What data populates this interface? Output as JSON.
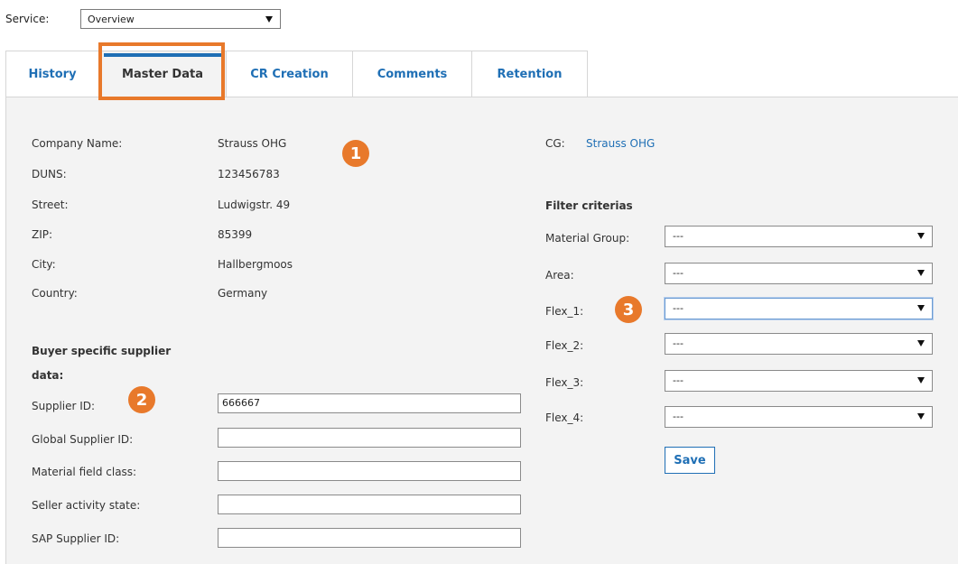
{
  "service": {
    "label": "Service:",
    "selected": "Overview"
  },
  "tabs": [
    {
      "label": "History"
    },
    {
      "label": "Master Data"
    },
    {
      "label": "CR Creation"
    },
    {
      "label": "Comments"
    },
    {
      "label": "Retention"
    }
  ],
  "master": {
    "company_name_label": "Company Name:",
    "company_name": "Strauss OHG",
    "duns_label": "DUNS:",
    "duns": "123456783",
    "street_label": "Street:",
    "street": "Ludwigstr. 49",
    "zip_label": "ZIP:",
    "zip": "85399",
    "city_label": "City:",
    "city": "Hallbergmoos",
    "country_label": "Country:",
    "country": "Germany"
  },
  "buyer": {
    "heading_line1": "Buyer specific supplier",
    "heading_line2": "data:",
    "supplier_id_label": "Supplier ID:",
    "supplier_id_value": "666667",
    "global_supplier_id_label": "Global Supplier ID:",
    "global_supplier_id_value": "",
    "material_field_class_label": "Material field class:",
    "material_field_class_value": "",
    "seller_activity_state_label": "Seller activity state:",
    "seller_activity_state_value": "",
    "sap_supplier_id_label": "SAP Supplier ID:",
    "sap_supplier_id_value": ""
  },
  "cg": {
    "label": "CG:",
    "value": "Strauss OHG"
  },
  "filter": {
    "heading": "Filter criterias",
    "material_group_label": "Material Group:",
    "material_group_value": "---",
    "area_label": "Area:",
    "area_value": "---",
    "flex1_label": "Flex_1:",
    "flex1_value": "---",
    "flex2_label": "Flex_2:",
    "flex2_value": "---",
    "flex3_label": "Flex_3:",
    "flex3_value": "---",
    "flex4_label": "Flex_4:",
    "flex4_value": "---"
  },
  "save_label": "Save",
  "badges": [
    "1",
    "2",
    "3"
  ],
  "colors": {
    "accent": "#1f6fb5",
    "highlight": "#e8792b",
    "panel": "#f3f3f3"
  }
}
